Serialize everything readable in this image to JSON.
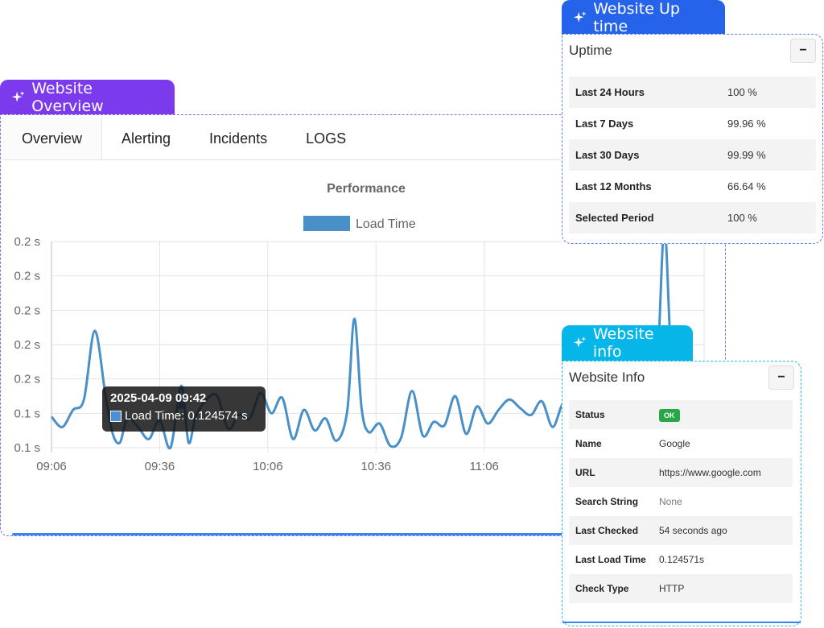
{
  "overview": {
    "badge": "Website Overview",
    "tabs": [
      "Overview",
      "Alerting",
      "Incidents",
      "LOGS"
    ],
    "active_tab": "Overview"
  },
  "uptime_section": {
    "badge": "Website Up time",
    "title": "Uptime",
    "collapse_label": "−",
    "rows": [
      {
        "label": "Last 24 Hours",
        "value": "100 %"
      },
      {
        "label": "Last 7 Days",
        "value": "99.96 %"
      },
      {
        "label": "Last 30 Days",
        "value": "99.99 %"
      },
      {
        "label": "Last 12 Months",
        "value": "66.64 %"
      },
      {
        "label": "Selected Period",
        "value": "100 %"
      }
    ]
  },
  "info_section": {
    "badge": "Website info",
    "title": "Website Info",
    "collapse_label": "−",
    "status_label": "Status",
    "status_value": "OK",
    "rows": [
      {
        "label": "Name",
        "value": "Google"
      },
      {
        "label": "URL",
        "value": "https://www.google.com"
      },
      {
        "label": "Search String",
        "value": "None"
      },
      {
        "label": "Last Checked",
        "value": "54 seconds ago"
      },
      {
        "label": "Last Load Time",
        "value": "0.124571s"
      },
      {
        "label": "Check Type",
        "value": "HTTP"
      }
    ]
  },
  "tooltip": {
    "title": "2025-04-09 09:42",
    "text": "Load Time: 0.124574 s"
  },
  "chart_data": {
    "type": "line",
    "title": "Performance",
    "legend": "top",
    "series": [
      {
        "name": "Load Time",
        "color": "#4a90c8"
      }
    ],
    "x_ticks": [
      "09:06",
      "09:36",
      "10:06",
      "10:36",
      "11:06"
    ],
    "y_ticks": [
      "0.2 s",
      "0.2 s",
      "0.2 s",
      "0.2 s",
      "0.2 s",
      "0.1 s",
      "0.1 s"
    ],
    "x_minutes": [
      0,
      3,
      6,
      9,
      12,
      15,
      17,
      19,
      21,
      24,
      27,
      30,
      33,
      36,
      38,
      40,
      43,
      46,
      49,
      52,
      55,
      58,
      61,
      64,
      67,
      70,
      73,
      76,
      79,
      82,
      84,
      86,
      88,
      91,
      94,
      97,
      100,
      103,
      106,
      109,
      112,
      115,
      118,
      121,
      124,
      127,
      130,
      133,
      136,
      139,
      142,
      145,
      148,
      151,
      154,
      157,
      160,
      163,
      166,
      168,
      170,
      172,
      175,
      178,
      181
    ],
    "y": [
      0.118,
      0.112,
      0.122,
      0.128,
      0.168,
      0.13,
      0.108,
      0.103,
      0.117,
      0.112,
      0.105,
      0.116,
      0.1,
      0.136,
      0.103,
      0.118,
      0.128,
      0.13,
      0.111,
      0.119,
      0.117,
      0.132,
      0.12,
      0.129,
      0.105,
      0.122,
      0.11,
      0.117,
      0.104,
      0.121,
      0.175,
      0.123,
      0.109,
      0.114,
      0.101,
      0.106,
      0.133,
      0.107,
      0.115,
      0.113,
      0.13,
      0.108,
      0.124,
      0.114,
      0.122,
      0.128,
      0.123,
      0.119,
      0.127,
      0.112,
      0.126,
      0.119,
      0.129,
      0.113,
      0.125,
      0.128,
      0.126,
      0.12,
      0.126,
      0.145,
      0.228,
      0.15,
      0.125,
      0.12,
      0.122
    ],
    "highlight_point": {
      "x_minute": 36,
      "y": 0.1246
    },
    "ylim": [
      0.1,
      0.22
    ],
    "xlim": [
      0,
      181
    ],
    "grid": true
  }
}
